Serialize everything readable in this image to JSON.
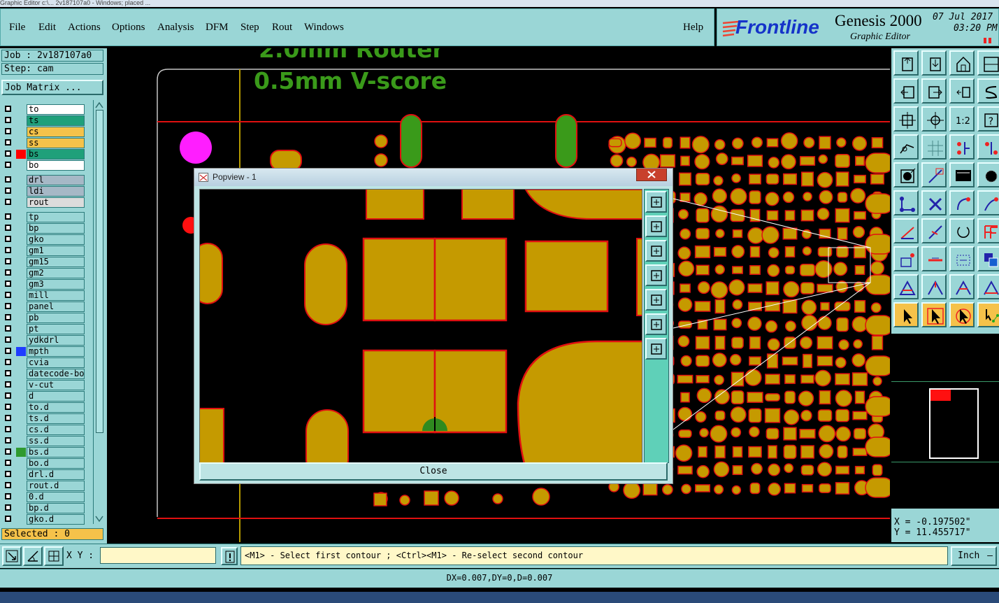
{
  "window_title": "Graphic Editor c:\\... 2v187107a0 - Windows; placed ...",
  "menu": [
    "File",
    "Edit",
    "Actions",
    "Options",
    "Analysis",
    "DFM",
    "Step",
    "Rout",
    "Windows"
  ],
  "help": "Help",
  "brand": {
    "logo": "Frontline",
    "product": "Genesis 2000",
    "subtitle": "Graphic Editor",
    "date": "07 Jul 2017",
    "time": "03:20 PM"
  },
  "job": {
    "job_label": "Job : 2v187107a0",
    "step_label": "Step: cam",
    "matrix_button": "Job Matrix ...",
    "selected": "Selected : 0"
  },
  "layers": [
    {
      "name": "to",
      "color": "#ffffff",
      "sw": ""
    },
    {
      "name": "ts",
      "color": "#1fa07a",
      "sw": ""
    },
    {
      "name": "cs",
      "color": "#f5c24a",
      "sw": ""
    },
    {
      "name": "ss",
      "color": "#f5c24a",
      "sw": ""
    },
    {
      "name": "bs",
      "color": "#1fa07a",
      "sw": "#ff0000"
    },
    {
      "name": "bo",
      "color": "#ffffff",
      "sw": ""
    },
    {
      "name": "drl",
      "color": "#a6b8c6",
      "sw": ""
    },
    {
      "name": "ldi",
      "color": "#a6b8c6",
      "sw": ""
    },
    {
      "name": "rout",
      "color": "#dcdcdc",
      "sw": ""
    },
    {
      "name": "tp",
      "color": "#9ad6d6",
      "sw": ""
    },
    {
      "name": "bp",
      "color": "#9ad6d6",
      "sw": ""
    },
    {
      "name": "gko",
      "color": "#9ad6d6",
      "sw": ""
    },
    {
      "name": "gm1",
      "color": "#9ad6d6",
      "sw": ""
    },
    {
      "name": "gm15",
      "color": "#9ad6d6",
      "sw": ""
    },
    {
      "name": "gm2",
      "color": "#9ad6d6",
      "sw": ""
    },
    {
      "name": "gm3",
      "color": "#9ad6d6",
      "sw": ""
    },
    {
      "name": "mill",
      "color": "#9ad6d6",
      "sw": ""
    },
    {
      "name": "panel",
      "color": "#9ad6d6",
      "sw": ""
    },
    {
      "name": "pb",
      "color": "#9ad6d6",
      "sw": ""
    },
    {
      "name": "pt",
      "color": "#9ad6d6",
      "sw": ""
    },
    {
      "name": "ydkdrl",
      "color": "#9ad6d6",
      "sw": ""
    },
    {
      "name": "mpth",
      "color": "#9ad6d6",
      "sw": "#1f3cff"
    },
    {
      "name": "cvia",
      "color": "#9ad6d6",
      "sw": ""
    },
    {
      "name": "datecode-bo",
      "color": "#9ad6d6",
      "sw": ""
    },
    {
      "name": "v-cut",
      "color": "#9ad6d6",
      "sw": ""
    },
    {
      "name": "d",
      "color": "#9ad6d6",
      "sw": ""
    },
    {
      "name": "to.d",
      "color": "#9ad6d6",
      "sw": ""
    },
    {
      "name": "ts.d",
      "color": "#9ad6d6",
      "sw": ""
    },
    {
      "name": "cs.d",
      "color": "#9ad6d6",
      "sw": ""
    },
    {
      "name": "ss.d",
      "color": "#9ad6d6",
      "sw": ""
    },
    {
      "name": "bs.d",
      "color": "#9ad6d6",
      "sw": "#2f9a2f"
    },
    {
      "name": "bo.d",
      "color": "#9ad6d6",
      "sw": ""
    },
    {
      "name": "drl.d",
      "color": "#9ad6d6",
      "sw": ""
    },
    {
      "name": "rout.d",
      "color": "#9ad6d6",
      "sw": ""
    },
    {
      "name": "0.d",
      "color": "#9ad6d6",
      "sw": ""
    },
    {
      "name": "bp.d",
      "color": "#9ad6d6",
      "sw": ""
    },
    {
      "name": "gko.d",
      "color": "#9ad6d6",
      "sw": ""
    }
  ],
  "canvas": {
    "text1": "2.0mm Router",
    "text2": "0.5mm V-score"
  },
  "popup": {
    "title": "Popview - 1",
    "close_label": "Close"
  },
  "coords": {
    "x": "X = -0.197502\"",
    "y": "Y = 11.455717\""
  },
  "bottom": {
    "xy_label": "X Y :",
    "xy_value": "",
    "prompt": "<M1> - Select first contour ; <Ctrl><M1> - Re-select second contour",
    "units": "Inch"
  },
  "status": "DX=0.007,DY=0,D=0.007"
}
